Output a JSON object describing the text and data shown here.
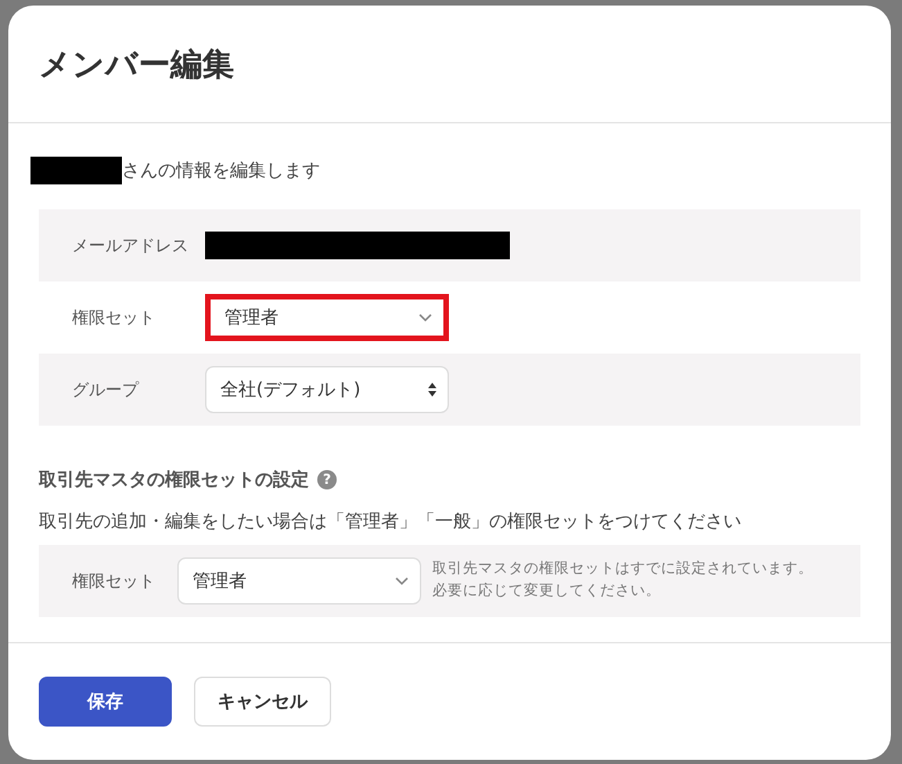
{
  "dialog": {
    "title": "メンバー編集"
  },
  "intro": {
    "redacted": true,
    "text": "さんの情報を編集します"
  },
  "fields": [
    {
      "kind": "readonly",
      "label": "メールアドレス",
      "redacted": true,
      "shaded": true
    },
    {
      "kind": "select",
      "label": "権限セット",
      "value": "管理者",
      "highlighted": true,
      "shaded": false
    },
    {
      "kind": "spinner",
      "label": "グループ",
      "value": "全社(デフォルト)",
      "highlighted": false,
      "shaded": true
    }
  ],
  "partner_section": {
    "heading": "取引先マスタの権限セットの設定",
    "help": "?",
    "description": "取引先の追加・編集をしたい場合は「管理者」「一般」の権限セットをつけてください",
    "field": {
      "label": "権限セット",
      "value": "管理者",
      "note": "取引先マスタの権限セットはすでに設定されています。必要に応じて変更してください。"
    }
  },
  "buttons": [
    {
      "label": "保存",
      "kind": "primary"
    },
    {
      "label": "キャンセル",
      "kind": "secondary"
    }
  ]
}
